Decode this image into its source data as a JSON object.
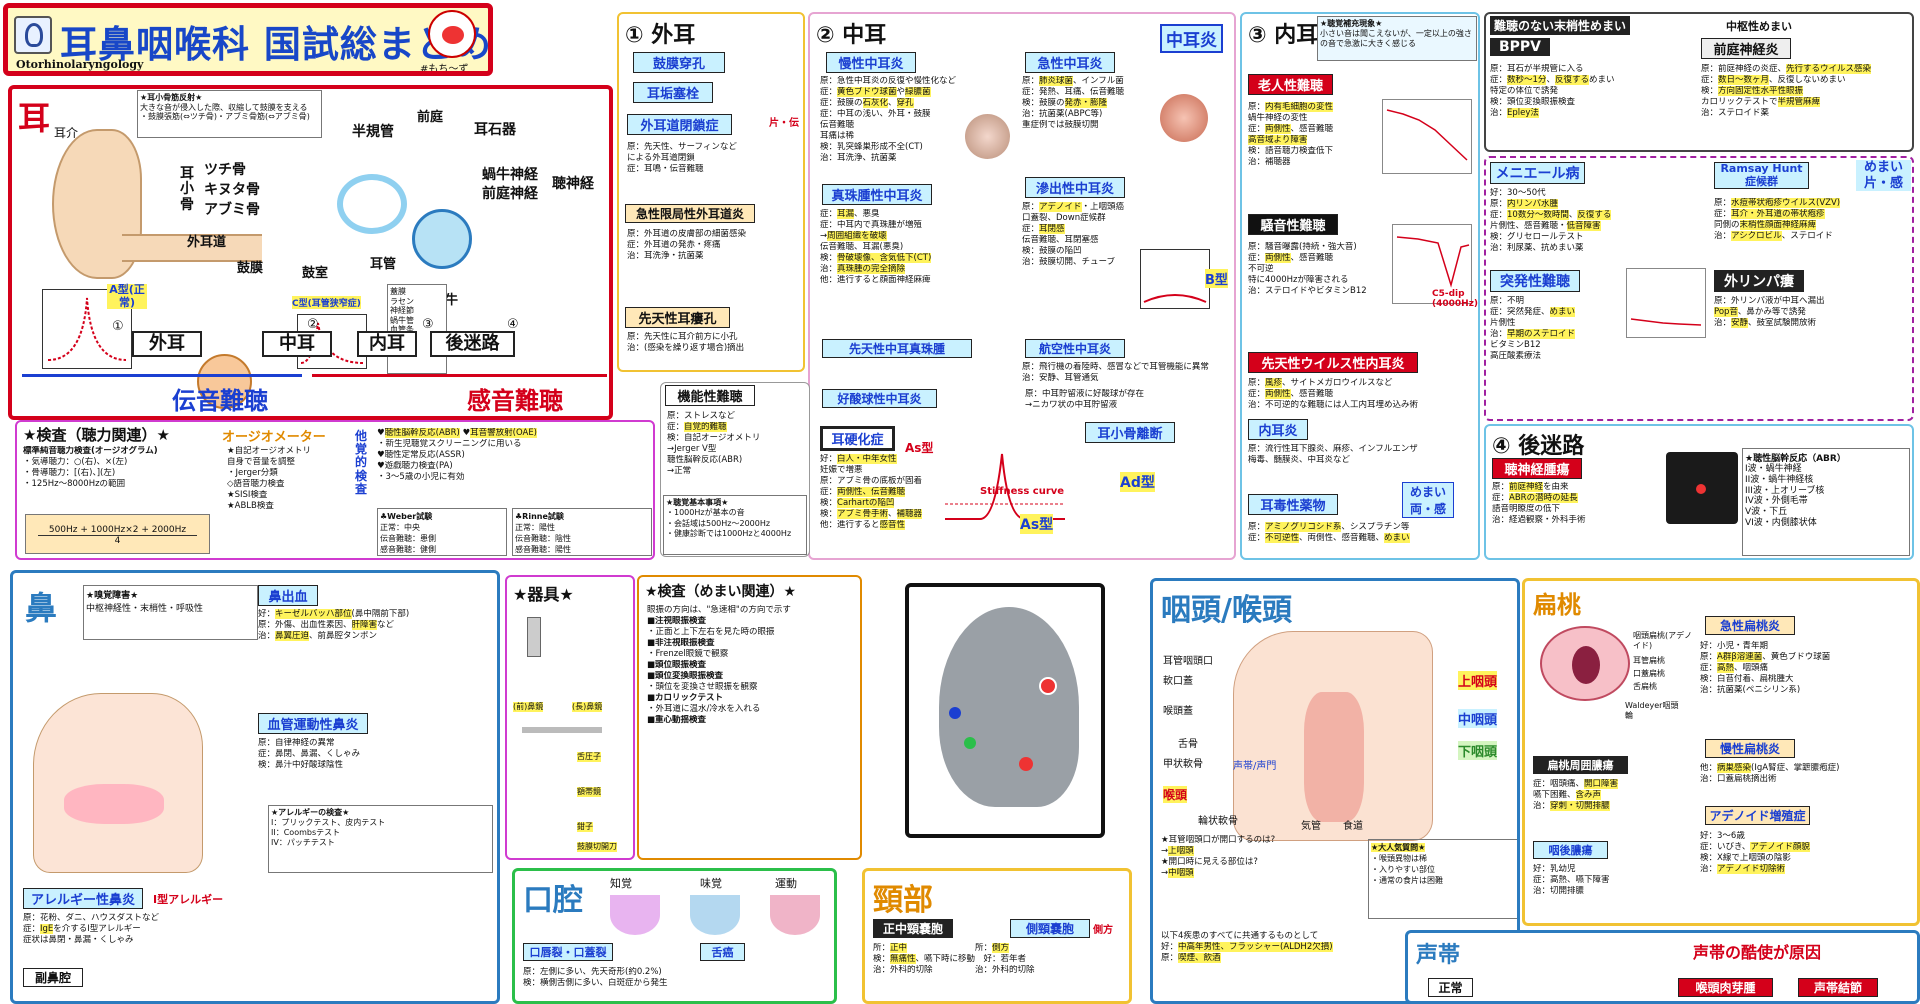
{
  "header": {
    "title": "耳鼻咽喉科 国試総まとめ",
    "subtitle": "Otorhinolaryngology",
    "author": "#もち〜ず"
  },
  "ear": {
    "section_label": "耳",
    "labels": [
      "耳介",
      "外耳道",
      "鼓膜",
      "鼓室",
      "耳管",
      "蝸牛",
      "半規管",
      "前庭",
      "耳石器",
      "蝸牛神経",
      "前庭神経",
      "聴神経",
      "ツチ骨",
      "キヌタ骨",
      "アブミ骨"
    ],
    "ossicle_group": "耳小骨",
    "tympanogram_a": "A型(正常)",
    "tympanogram_c": "C型(耳管狭窄症)",
    "parts": [
      "外耳",
      "中耳",
      "内耳",
      "後迷路"
    ],
    "conductive": "伝音難聴",
    "sensorineural": "感音難聴",
    "numbers": [
      "①",
      "②",
      "③",
      "④"
    ]
  },
  "outer_ear": {
    "title": "① 外耳",
    "items": [
      "鼓膜穿孔",
      "耳垢塞栓",
      "外耳道閉鎖症",
      "急性限局性外耳道炎",
      "先天性耳瘻孔"
    ],
    "note": "片・伝"
  },
  "middle_ear": {
    "title": "② 中耳",
    "badge": "中耳炎",
    "items": [
      "慢性中耳炎",
      "急性中耳炎",
      "真珠腫性中耳炎",
      "滲出性中耳炎",
      "先天性中耳真珠腫",
      "航空性中耳炎",
      "好酸球性中耳炎",
      "耳硬化症",
      "耳小骨離断"
    ],
    "b_type": "B型",
    "as_type": "As型",
    "ad_type": "Ad型",
    "functional": "機能性難聴",
    "stiffness": "Stiffness curve"
  },
  "inner_ear": {
    "title": "③ 内耳",
    "items": [
      "老人性難聴",
      "騒音性難聴",
      "先天性ウイルス性内耳炎",
      "内耳炎",
      "耳毒性薬物"
    ],
    "c5dip": "C5-dip (4000Hz)",
    "dizzy_note": "めまい 両・感"
  },
  "vertigo": {
    "title": "難聴のない末梢性めまい",
    "sub": "中枢性めまい",
    "items": [
      "BPPV",
      "前庭神経炎",
      "メニエール病",
      "Ramsay Hunt症候群",
      "突発性難聴",
      "外リンパ瘻"
    ],
    "note": "めまい 片・感"
  },
  "retro": {
    "title": "④ 後迷路",
    "item": "聴神経腫瘍",
    "abr_title": "★聴性脳幹反応（ABR）",
    "waves": [
      "I波・蝸牛神経",
      "II波・蝸牛神経核",
      "III波・上オリーブ核",
      "IV波・外側毛帯",
      "V波・下丘",
      "VI波・内側膝状体"
    ]
  },
  "exam": {
    "title": "★検査（聴力関連）★",
    "audiometer": "オージオメーター",
    "items": [
      "標準純音聴力検査(オージオグラム)",
      "自記オージオメトリ",
      "語音聴力検査",
      "SISI検査",
      "ABLB検査",
      "聴性脳幹反応(ABR)",
      "耳音響放射(OAE)",
      "聴性定常反応(ASSR)",
      "遊戯聴力検査(PA)",
      "Weber試験",
      "Rinne試験"
    ],
    "formula": "500Hz + 1000Hz×2 + 2000Hz",
    "formula_den": "4",
    "side_label": "他覚的検査"
  },
  "nose": {
    "title": "鼻",
    "items": [
      "嗅覚障害",
      "鼻出血",
      "血管運動性鼻炎",
      "アレルギー性鼻炎",
      "副鼻腔"
    ],
    "allergy_title": "★アレルギーの検査★",
    "allergy_type": "I型アレルギー"
  },
  "instruments": {
    "title": "★器具★",
    "items": [
      "(前)鼻鏡",
      "(長)鼻鏡",
      "舌圧子",
      "額帯鏡",
      "鉗子",
      "鼓膜切開刀"
    ]
  },
  "dizzy_exam": {
    "title": "★検査（めまい関連）★",
    "items": [
      "注視眼振検査",
      "非注視眼振検査",
      "頭位眼振検査",
      "頭位変換眼振検査",
      "カロリックテスト",
      "重心動揺検査"
    ],
    "frenzel": "Frenzel眼鏡"
  },
  "oral": {
    "title": "口腔",
    "labels": [
      "知覚",
      "味覚",
      "運動"
    ],
    "items": [
      "口唇裂・口蓋裂",
      "舌癌"
    ]
  },
  "neck": {
    "title": "頸部",
    "items": [
      "正中頸嚢胞",
      "側頸嚢胞"
    ],
    "note": "側方"
  },
  "pharynx": {
    "title": "咽頭/喉頭",
    "regions": [
      "上咽頭",
      "中咽頭",
      "下咽頭"
    ],
    "labels": [
      "耳管咽頭口",
      "軟口蓋",
      "喉頭蓋",
      "舌骨",
      "甲状軟骨",
      "声帯/声門",
      "輪状軟骨",
      "気管",
      "食道",
      "喉頭"
    ],
    "question1": "★耳管咽頭口が開口するのは?",
    "answer1": "上咽頭",
    "question2": "★開口時に見える部位は?",
    "answer2": "中咽頭",
    "common": "以下4疾患のすべてに共通するものとして",
    "common2": "中高年男性、フラッシャー(ALDH2欠損)",
    "common3": "喫煙、飲酒",
    "foreign": "★大人気質問★"
  },
  "tonsil": {
    "title": "扁桃",
    "items": [
      "急性扁桃炎",
      "慢性扁桃炎",
      "扁桃周囲膿瘍",
      "アデノイド増殖症",
      "咽後膿瘍"
    ],
    "labels": [
      "咽頭扁桃(アデノイド)",
      "耳管扁桃",
      "口蓋扁桃",
      "舌扁桃",
      "Waldeyer咽頭輪"
    ]
  },
  "voice": {
    "title": "声帯",
    "items": [
      "正常",
      "喉頭肉芽腫",
      "声帯結節"
    ],
    "cause": "声帯の酷使が原因"
  }
}
